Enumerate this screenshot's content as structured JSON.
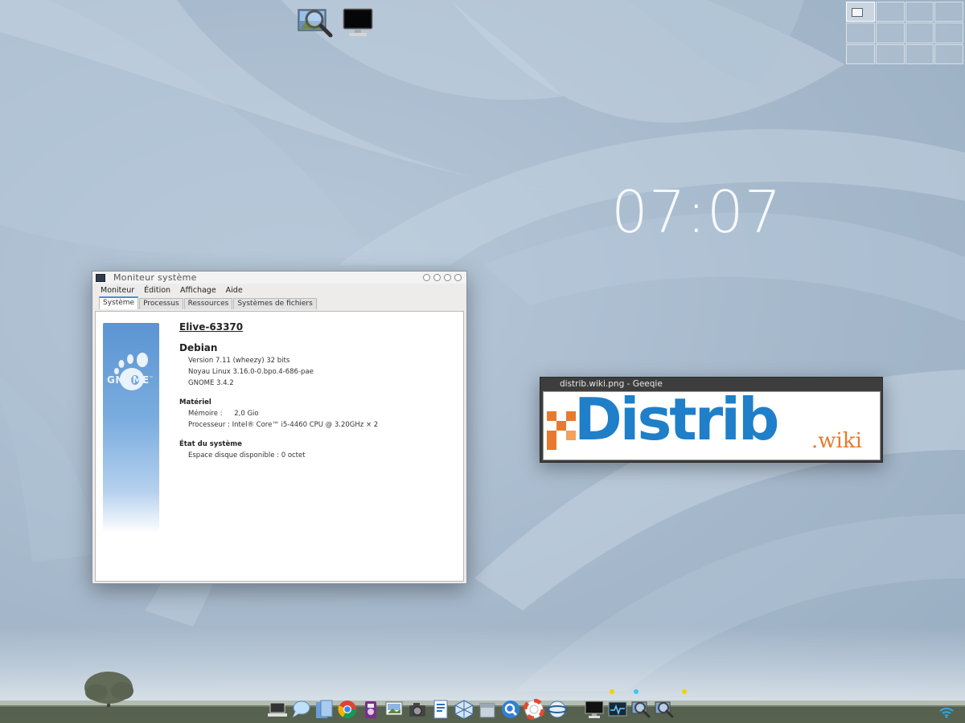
{
  "clock": {
    "time": "07:07"
  },
  "desktop_icons": [
    {
      "name": "image-viewer-icon"
    },
    {
      "name": "monitor-icon"
    }
  ],
  "system_monitor": {
    "title": "Moniteur système",
    "menu": [
      "Moniteur",
      "Édition",
      "Affichage",
      "Aide"
    ],
    "tabs": [
      "Système",
      "Processus",
      "Ressources",
      "Systèmes de fichiers"
    ],
    "active_tab": "Système",
    "logo_text": "GNOME",
    "logo_tm": "™",
    "hostname": "Elive-63370",
    "distro": "Debian",
    "distro_lines": [
      "Version 7.11 (wheezy) 32 bits",
      "Noyau Linux 3.16.0-0.bpo.4-686-pae",
      "GNOME 3.4.2"
    ],
    "hardware_title": "Matériel",
    "memory_label": "Mémoire :",
    "memory_value": "2,0 Gio",
    "cpu_label": "Processeur :",
    "cpu_value": "Intel® Core™ i5-4460 CPU @ 3.20GHz × 2",
    "status_title": "État du système",
    "disk_label": "Espace disque disponible :",
    "disk_value": "0 octet"
  },
  "geeqie": {
    "title": "distrib.wiki.png - Geeqie",
    "logo_main": "Distrib",
    "logo_suffix": ".wiki"
  },
  "colors": {
    "accent_blue": "#1f7fc9",
    "accent_orange": "#e77a2e",
    "dock_dot_yellow": "#f5d000",
    "dock_dot_cyan": "#3ac7ee"
  }
}
